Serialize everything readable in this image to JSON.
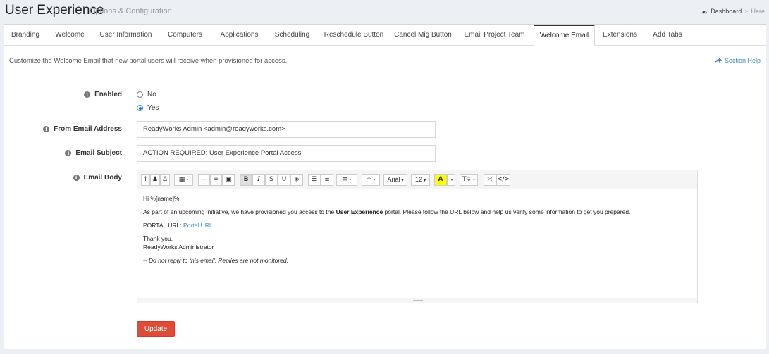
{
  "header": {
    "title": "User Experience",
    "subtitle": "Options & Configuration",
    "breadcrumb": {
      "home": "Dashboard",
      "separator": ">",
      "current": "Here"
    }
  },
  "tabs": [
    {
      "label": "Branding"
    },
    {
      "label": "Welcome"
    },
    {
      "label": "User Information"
    },
    {
      "label": "Computers"
    },
    {
      "label": "Applications"
    },
    {
      "label": "Scheduling"
    },
    {
      "label": "Reschedule Button"
    },
    {
      "label": "Cancel Mig Button"
    },
    {
      "label": "Email Project Team"
    },
    {
      "label": "Welcome Email",
      "active": true
    },
    {
      "label": "Extensions"
    },
    {
      "label": "Add Tabs"
    }
  ],
  "description": "Customize the Welcome Email that new portal users will receive when provisioned for access.",
  "section_help": "Section Help",
  "form": {
    "enabled": {
      "label": "Enabled",
      "options": [
        {
          "label": "No",
          "selected": false
        },
        {
          "label": "Yes",
          "selected": true
        }
      ]
    },
    "from_email": {
      "label": "From Email Address",
      "value": "ReadyWorks Admin <admin@readyworks.com>"
    },
    "subject": {
      "label": "Email Subject",
      "value": "ACTION REQUIRED: User Experience Portal Access"
    },
    "body": {
      "label": "Email Body",
      "toolbar": {
        "font": "Arial",
        "size": "12"
      },
      "greeting": "Hi %[name]%,",
      "p1_pre": "As part of an upcoming initiative, we have provisioned you access to the ",
      "p1_bold": "User Experience",
      "p1_post": " portal. Please follow the URL below and help us verify some information to get you prepared.",
      "url_label": "PORTAL URL: ",
      "url_link": "Portal URL",
      "closing": "Thank you,",
      "signature": "ReadyWorks Administrator",
      "footer": "-- Do not reply to this email. Replies are not monitored."
    },
    "submit_label": "Update"
  },
  "colors": {
    "accent": "#3c8dbc",
    "danger": "#dd4b39",
    "highlight": "#ffff00"
  }
}
